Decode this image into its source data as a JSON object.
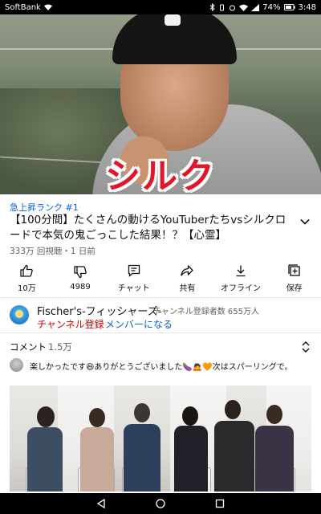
{
  "status_bar": {
    "carrier": "SoftBank",
    "battery": "74%",
    "time": "3:48"
  },
  "video": {
    "caption_overlay": "シルク"
  },
  "info": {
    "rank_label": "急上昇ランク #1",
    "title": "【100分間】たくさんの動けるYouTuberたちvsシルクロードで本気の鬼ごっこした結果！？【心霊】",
    "views": "333万 回視聴・1 日前"
  },
  "actions": [
    {
      "icon": "thumbs-up-icon",
      "label": "10万"
    },
    {
      "icon": "thumbs-down-icon",
      "label": "4989"
    },
    {
      "icon": "chat-icon",
      "label": "チャット"
    },
    {
      "icon": "share-icon",
      "label": "共有"
    },
    {
      "icon": "download-icon",
      "label": "オフライン"
    },
    {
      "icon": "save-playlist-icon",
      "label": "保存"
    }
  ],
  "channel": {
    "name": "Fischer's-フィッシャーズ-",
    "subscribers": "チャンネル登録者数 655万人",
    "subscribe_label": "チャンネル登録",
    "member_label": "メンバーになる"
  },
  "comments": {
    "label": "コメント",
    "count": "1.5万",
    "top_comment": "楽しかったです😆ありがとうございました🍆🙇🧡次はスパーリングで。"
  },
  "colors": {
    "accent_blue": "#065fd4",
    "subscribe_red": "#cc0000",
    "caption_red": "#e0162b"
  }
}
